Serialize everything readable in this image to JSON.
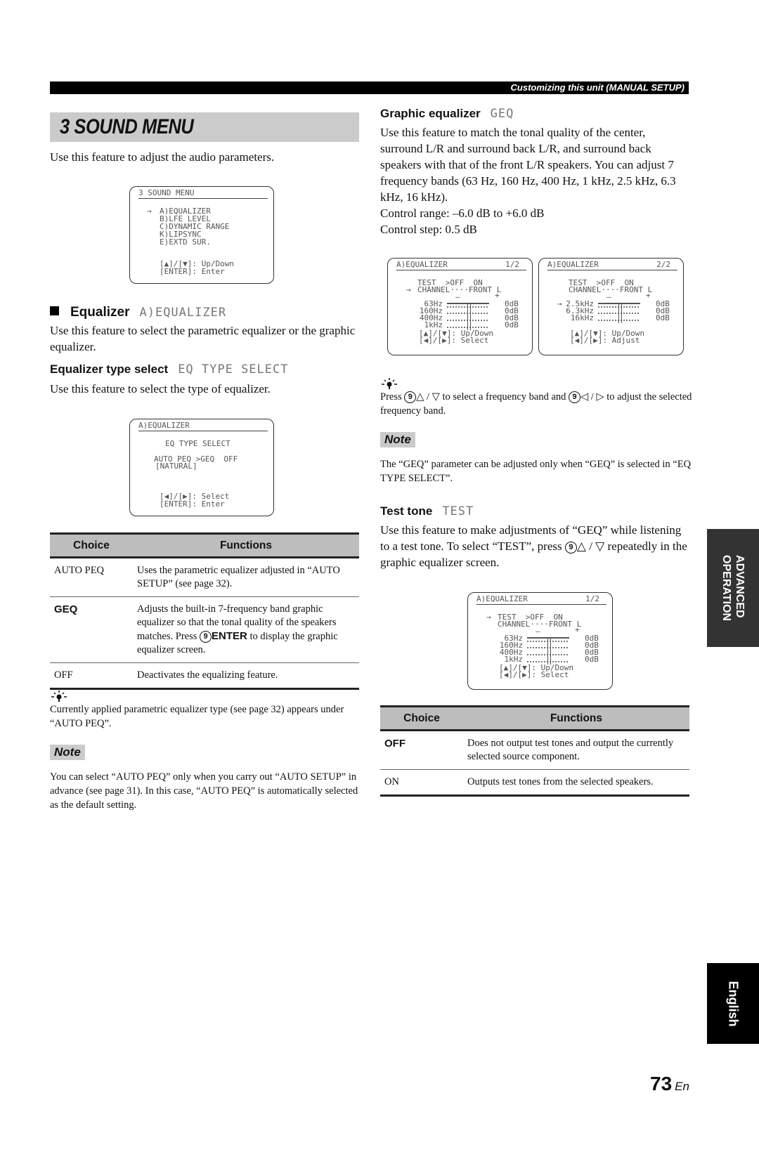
{
  "header": {
    "section": "Customizing this unit (MANUAL SETUP)"
  },
  "title": "3 SOUND MENU",
  "intro": "Use this feature to adjust the audio parameters.",
  "lcd_sound_menu": {
    "title": "3 SOUND MENU",
    "cursor": "→",
    "items": [
      "A)EQUALIZER",
      "B)LFE LEVEL",
      "C)DYNAMIC RANGE",
      "K)LIPSYNC",
      "E)EXTD SUR."
    ],
    "help": [
      "[▲]/[▼]: Up/Down",
      "[ENTER]: Enter"
    ]
  },
  "equalizer": {
    "heading": "Equalizer",
    "lcd_tag": "A)EQUALIZER",
    "body": "Use this feature to select the parametric equalizer or the graphic equalizer."
  },
  "eq_type": {
    "heading": "Equalizer type select",
    "lcd_tag": "EQ TYPE SELECT",
    "body": "Use this feature to select the type of equalizer.",
    "lcd": {
      "title": "A)EQUALIZER",
      "line1": "EQ TYPE SELECT",
      "line2": "AUTO PEQ >GEQ  OFF",
      "line3": "[NATURAL]",
      "help": [
        "[◀]/[▶]: Select",
        "[ENTER]: Enter"
      ]
    }
  },
  "table1": {
    "headers": [
      "Choice",
      "Functions"
    ],
    "rows": [
      {
        "choice": "AUTO PEQ",
        "bold": false,
        "func": "Uses the parametric equalizer adjusted in “AUTO SETUP” (see page 32)."
      },
      {
        "choice": "GEQ",
        "bold": true,
        "func_pre": "Adjusts the built-in 7-frequency band graphic equalizer so that the tonal quality of the speakers matches. Press ",
        "func_key_num": "9",
        "func_key": "ENTER",
        "func_post": " to display the graphic equalizer screen."
      },
      {
        "choice": "OFF",
        "bold": false,
        "func": "Deactivates the equalizing feature."
      }
    ]
  },
  "tip1": "Currently applied parametric equalizer type (see page 32) appears under “AUTO PEQ”.",
  "note1": {
    "label": "Note",
    "body": "You can select “AUTO PEQ” only when you carry out “AUTO SETUP” in advance (see page 31). In this case, “AUTO PEQ” is automatically selected as the default setting."
  },
  "geq": {
    "heading": "Graphic equalizer",
    "lcd_tag": "GEQ",
    "body": "Use this feature to match the tonal quality of the center, surround L/R and surround back L/R, and surround back speakers with that of the front L/R speakers. You can adjust 7 frequency bands (63 Hz, 160 Hz, 400 Hz, 1 kHz, 2.5 kHz, 6.3 kHz, 16 kHz).",
    "range": "Control range: –6.0 dB to +6.0 dB",
    "step": "Control step: 0.5 dB",
    "lcd1": {
      "title": "A)EQUALIZER",
      "page": "1/2",
      "test": "TEST  >OFF  ON",
      "channel": "CHANNEL····FRONT L",
      "scale_minus": "–",
      "scale_plus": "+",
      "bands": [
        {
          "freq": "63Hz",
          "value": "0dB"
        },
        {
          "freq": "160Hz",
          "value": "0dB"
        },
        {
          "freq": "400Hz",
          "value": "0dB"
        },
        {
          "freq": "1kHz",
          "value": "0dB"
        }
      ],
      "help": [
        "[▲]/[▼]: Up/Down",
        "[◀]/[▶]: Select"
      ]
    },
    "lcd2": {
      "title": "A)EQUALIZER",
      "page": "2/2",
      "test": "TEST  >OFF  ON",
      "channel": "CHANNEL····FRONT L",
      "scale_minus": "–",
      "scale_plus": "+",
      "bands": [
        {
          "freq": "2.5kHz",
          "value": "0dB"
        },
        {
          "freq": "6.3kHz",
          "value": "0dB"
        },
        {
          "freq": "16kHz",
          "value": "0dB"
        }
      ],
      "help": [
        "[▲]/[▼]: Up/Down",
        "[◀]/[▶]: Adjust"
      ]
    },
    "tip_pre": "Press ",
    "tip_key": "9",
    "tip_mid1": "△ / ▽ to select a frequency band and ",
    "tip_mid2": "◁ / ▷ to adjust the selected frequency band."
  },
  "note2": {
    "label": "Note",
    "body": "The “GEQ” parameter can be adjusted only when “GEQ” is selected in “EQ TYPE SELECT”."
  },
  "test_tone": {
    "heading": "Test tone",
    "lcd_tag": "TEST",
    "body_pre": "Use this feature to make adjustments of “GEQ” while listening to a test tone. To select “TEST”, press ",
    "key": "9",
    "body_post": "△ / ▽ repeatedly in the graphic equalizer screen.",
    "lcd": {
      "title": "A)EQUALIZER",
      "page": "1/2",
      "test": "TEST  >OFF  ON",
      "channel": "CHANNEL····FRONT L",
      "scale_minus": "–",
      "scale_plus": "+",
      "bands": [
        {
          "freq": "63Hz",
          "value": "0dB"
        },
        {
          "freq": "160Hz",
          "value": "0dB"
        },
        {
          "freq": "400Hz",
          "value": "0dB"
        },
        {
          "freq": "1kHz",
          "value": "0dB"
        }
      ],
      "help": [
        "[▲]/[▼]: Up/Down",
        "[◀]/[▶]: Select"
      ]
    }
  },
  "table2": {
    "headers": [
      "Choice",
      "Functions"
    ],
    "rows": [
      {
        "choice": "OFF",
        "bold": true,
        "func": "Does not output test tones and output the currently selected source component."
      },
      {
        "choice": "ON",
        "bold": false,
        "func": "Outputs test tones from the selected speakers."
      }
    ]
  },
  "side_tabs": {
    "section": [
      "ADVANCED",
      "OPERATION"
    ],
    "language": "English"
  },
  "page": {
    "number": "73",
    "suffix": "En"
  }
}
